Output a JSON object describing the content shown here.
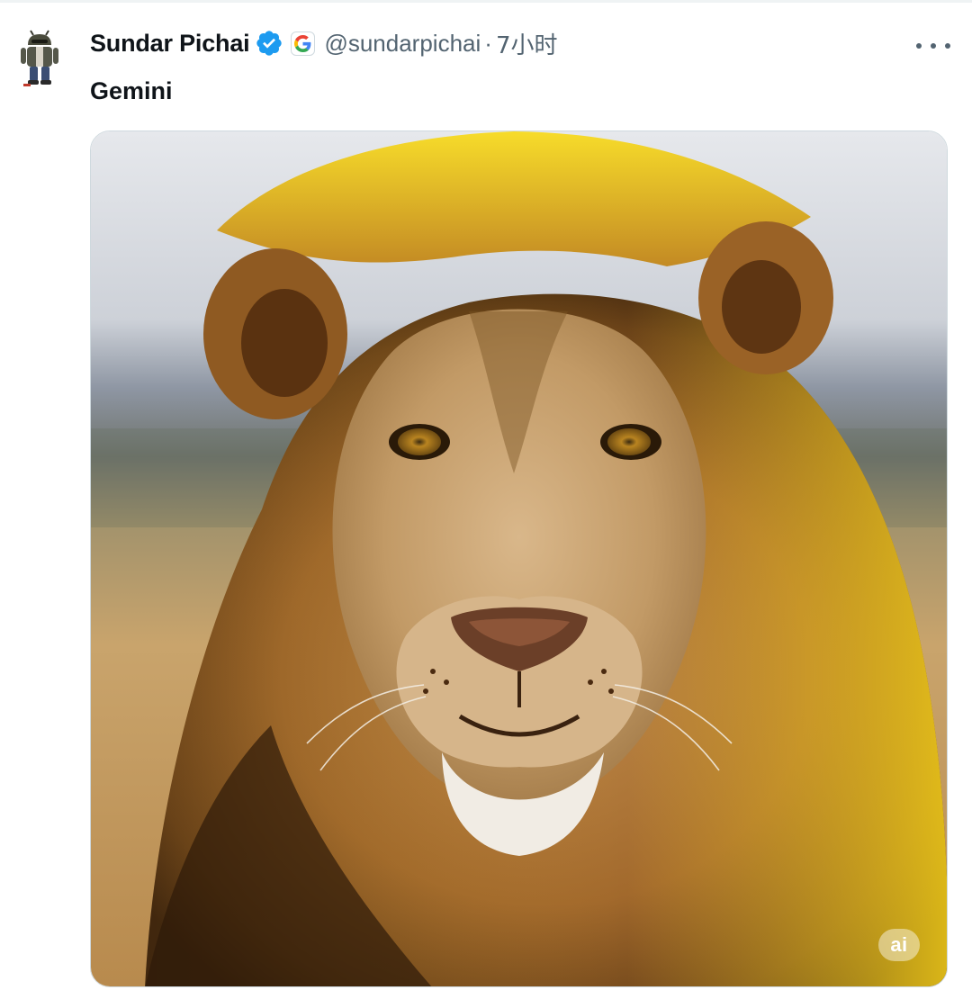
{
  "tweet": {
    "author": {
      "display_name": "Sundar Pichai",
      "handle": "@sundarpichai",
      "verified_icon": "verified-badge-icon",
      "affiliation_icon": "google-g-icon"
    },
    "separator": "·",
    "timestamp": "7小时",
    "more_icon": "more-dots-icon",
    "text": "Gemini",
    "media": {
      "badge_label": "ai"
    }
  },
  "colors": {
    "text_primary": "#0f1419",
    "text_secondary": "#536471",
    "verified_blue": "#1d9bf0",
    "border": "#cfd9de"
  }
}
